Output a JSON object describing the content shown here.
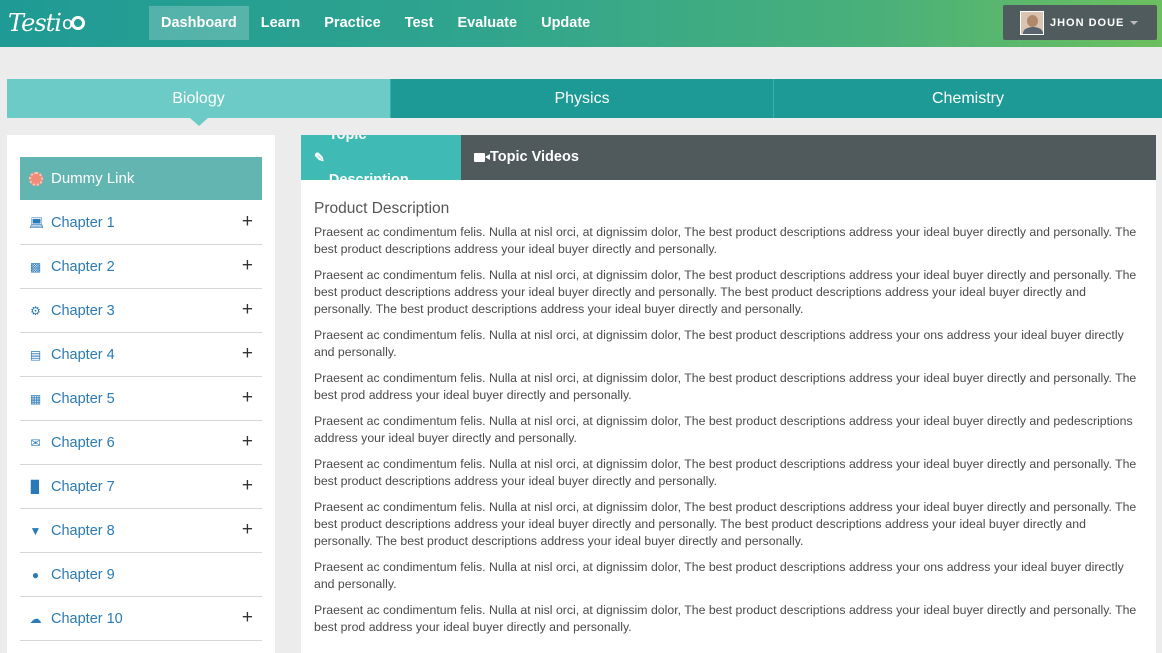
{
  "app": {
    "logo_text": "Testi",
    "logo_tail": "o"
  },
  "nav": {
    "items": [
      "Dashboard",
      "Learn",
      "Practice",
      "Test",
      "Evaluate",
      "Update"
    ],
    "active_index": 0
  },
  "user": {
    "name": "JHON DOUE"
  },
  "subjects": {
    "tabs": [
      "Biology",
      "Physics",
      "Chemistry"
    ],
    "active_index": 0
  },
  "sidebar": {
    "dummy_link": "Dummy Link",
    "chapters": [
      {
        "label": "Chapter 1",
        "icon": "laptop-icon",
        "expandable": true
      },
      {
        "label": "Chapter 2",
        "icon": "book-icon",
        "expandable": true
      },
      {
        "label": "Chapter 3",
        "icon": "gears-icon",
        "expandable": true
      },
      {
        "label": "Chapter 4",
        "icon": "list-alt-icon",
        "expandable": true
      },
      {
        "label": "Chapter 5",
        "icon": "grid-icon",
        "expandable": true
      },
      {
        "label": "Chapter 6",
        "icon": "envelope-icon",
        "expandable": true
      },
      {
        "label": "Chapter 7",
        "icon": "bar-chart-icon",
        "expandable": true
      },
      {
        "label": "Chapter 8",
        "icon": "cart-icon",
        "expandable": true
      },
      {
        "label": "Chapter 9",
        "icon": "map-marker-icon",
        "expandable": false
      },
      {
        "label": "Chapter 10",
        "icon": "comments-icon",
        "expandable": true
      }
    ],
    "plus_symbol": "+"
  },
  "content": {
    "tabs": [
      "Topic Description",
      "Topic Videos"
    ],
    "active_tab": 0,
    "title": "Product Description",
    "paragraphs": [
      "Praesent ac condimentum felis. Nulla at nisl orci, at dignissim dolor, The best product descriptions address your ideal buyer directly and personally. The best product descriptions address your ideal buyer directly and personally.",
      "Praesent ac condimentum felis. Nulla at nisl orci, at dignissim dolor, The best product descriptions address your ideal buyer directly and personally. The best product descriptions address your ideal buyer directly and personally. The best product descriptions address your ideal buyer directly and personally. The best product descriptions address your ideal buyer directly and personally.",
      "Praesent ac condimentum felis. Nulla at nisl orci, at dignissim dolor, The best product descriptions address your ons address your ideal buyer directly and personally.",
      "Praesent ac condimentum felis. Nulla at nisl orci, at dignissim dolor, The best product descriptions address your ideal buyer directly and personally. The best prod address your ideal buyer directly and personally.",
      "Praesent ac condimentum felis. Nulla at nisl orci, at dignissim dolor, The best product descriptions address your ideal buyer directly and pedescriptions address your ideal buyer directly and personally.",
      "Praesent ac condimentum felis. Nulla at nisl orci, at dignissim dolor, The best product descriptions address your ideal buyer directly and personally. The best product descriptions address your ideal buyer directly and personally.",
      "Praesent ac condimentum felis. Nulla at nisl orci, at dignissim dolor, The best product descriptions address your ideal buyer directly and personally. The best product descriptions address your ideal buyer directly and personally. The best product descriptions address your ideal buyer directly and personally. The best product descriptions address your ideal buyer directly and personally.",
      "Praesent ac condimentum felis. Nulla at nisl orci, at dignissim dolor, The best product descriptions address your ons address your ideal buyer directly and personally.",
      "Praesent ac condimentum felis. Nulla at nisl orci, at dignissim dolor, The best product descriptions address your ideal buyer directly and personally. The best prod address your ideal buyer directly and personally."
    ]
  }
}
